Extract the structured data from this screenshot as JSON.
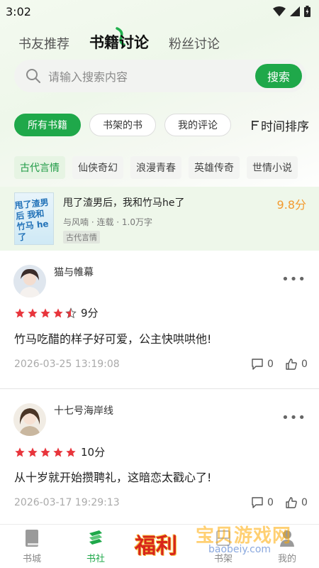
{
  "status": {
    "time": "3:02"
  },
  "top_tabs": [
    {
      "label": "书友推荐"
    },
    {
      "label": "书籍讨论"
    },
    {
      "label": "粉丝讨论"
    }
  ],
  "search": {
    "placeholder": "请输入搜索内容",
    "button": "搜索"
  },
  "filters": [
    {
      "label": "所有书籍"
    },
    {
      "label": "书架的书"
    },
    {
      "label": "我的评论"
    }
  ],
  "sort_label": "时间排序",
  "genres": [
    {
      "label": "古代言情"
    },
    {
      "label": "仙侠奇幻"
    },
    {
      "label": "浪漫青春"
    },
    {
      "label": "英雄传奇"
    },
    {
      "label": "世情小说"
    }
  ],
  "book": {
    "title": "甩了渣男后，我和竹马he了",
    "score": "9.8分",
    "meta": "与风喃 · 连载 · 1.0万字",
    "tag": "古代言情",
    "cover_text": "甩了渣男后 我和竹马 he了"
  },
  "comments": [
    {
      "user": "猫与帷幕",
      "rating": 4.5,
      "score": "9分",
      "text": "竹马吃醋的样子好可爱，公主快哄哄他!",
      "date": "2026-03-25 13:19:08",
      "replies": "0",
      "likes": "0"
    },
    {
      "user": "十七号海岸线",
      "rating": 5,
      "score": "10分",
      "text": "从十岁就开始攒聘礼，这暗恋太戳心了!",
      "date": "2026-03-17 19:29:13",
      "replies": "0",
      "likes": "0"
    }
  ],
  "bottom_nav": [
    {
      "label": "书城",
      "icon": "book-icon"
    },
    {
      "label": "书社",
      "icon": "book-stack-icon"
    },
    {
      "label": "福利",
      "icon": "gift-icon"
    },
    {
      "label": "书架",
      "icon": "shelf-icon"
    },
    {
      "label": "我的",
      "icon": "user-icon"
    }
  ],
  "watermark": {
    "text": "宝贝游戏网",
    "url": "baobeiy.com"
  },
  "colors": {
    "accent": "#1fa84a",
    "score": "#f39a2e",
    "star": "#e8353c"
  }
}
